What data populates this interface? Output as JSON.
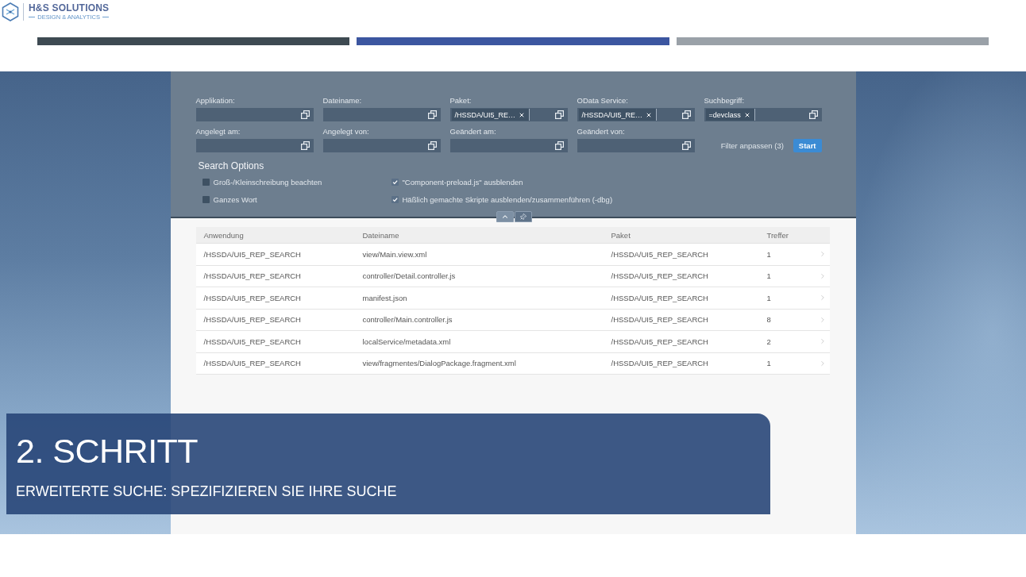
{
  "logo": {
    "name": "H&S SOLUTIONS",
    "tagline": "DESIGN & ANALYTICS"
  },
  "progress_segments": [
    {
      "color": "#3e4a52"
    },
    {
      "color": "#3c56a0"
    },
    {
      "color": "#9aa1a8"
    }
  ],
  "filter_bar": {
    "fields": [
      {
        "label": "Applikation:"
      },
      {
        "label": "Dateiname:"
      },
      {
        "label": "Paket:",
        "tokens": [
          "/HSSDA/UI5_RE…"
        ]
      },
      {
        "label": "OData Service:",
        "tokens": [
          "/HSSDA/UI5_RE…"
        ]
      },
      {
        "label": "Suchbegriff:",
        "tokens": [
          "=devclass"
        ]
      },
      {
        "label": "Angelegt am:"
      },
      {
        "label": "Angelegt von:"
      },
      {
        "label": "Geändert am:"
      },
      {
        "label": "Geändert von:"
      }
    ],
    "adapt_filters": "Filter anpassen (3)",
    "go_button": "Start"
  },
  "search_options": {
    "title": "Search Options",
    "items": [
      {
        "label": "Groß-/Kleinschreibung beachten",
        "checked": false
      },
      {
        "label": "\"Component-preload.js\" ausblenden",
        "checked": true
      },
      {
        "label": "Ganzes Wort",
        "checked": false
      },
      {
        "label": "Häßlich gemachte Skripte ausblenden/zusammenführen (-dbg)",
        "checked": true
      }
    ]
  },
  "table": {
    "columns": [
      "Anwendung",
      "Dateiname",
      "Paket",
      "Treffer"
    ],
    "rows": [
      [
        "/HSSDA/UI5_REP_SEARCH",
        "view/Main.view.xml",
        "/HSSDA/UI5_REP_SEARCH",
        "1"
      ],
      [
        "/HSSDA/UI5_REP_SEARCH",
        "controller/Detail.controller.js",
        "/HSSDA/UI5_REP_SEARCH",
        "1"
      ],
      [
        "/HSSDA/UI5_REP_SEARCH",
        "manifest.json",
        "/HSSDA/UI5_REP_SEARCH",
        "1"
      ],
      [
        "/HSSDA/UI5_REP_SEARCH",
        "controller/Main.controller.js",
        "/HSSDA/UI5_REP_SEARCH",
        "8"
      ],
      [
        "/HSSDA/UI5_REP_SEARCH",
        "localService/metadata.xml",
        "/HSSDA/UI5_REP_SEARCH",
        "2"
      ],
      [
        "/HSSDA/UI5_REP_SEARCH",
        "view/fragmentes/DialogPackage.fragment.xml",
        "/HSSDA/UI5_REP_SEARCH",
        "1"
      ]
    ]
  },
  "banner": {
    "title": "2. SCHRITT",
    "subtitle": "ERWEITERTE SUCHE: SPEZIFIZIEREN SIE IHRE SUCHE"
  }
}
